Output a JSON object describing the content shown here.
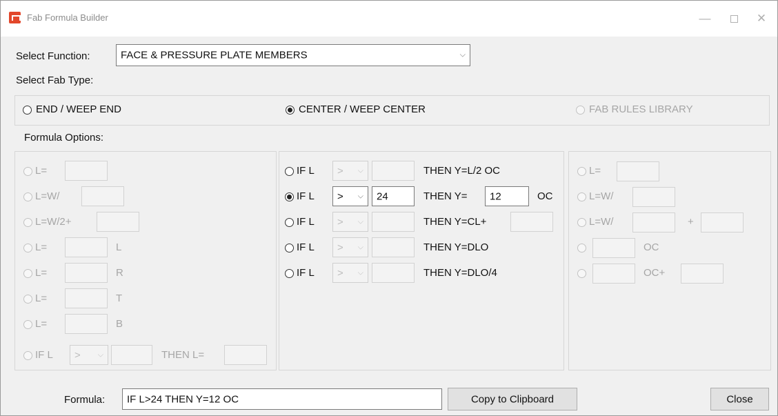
{
  "window": {
    "title": "Fab Formula Builder",
    "min_glyph": "—",
    "close_glyph": "✕"
  },
  "select_function": {
    "label": "Select Function:",
    "value": "FACE & PRESSURE PLATE MEMBERS"
  },
  "fab_type": {
    "label": "Select Fab Type:",
    "options": [
      {
        "label": "END / WEEP END",
        "checked": false,
        "enabled": true
      },
      {
        "label": "CENTER / WEEP CENTER",
        "checked": true,
        "enabled": true
      },
      {
        "label": "FAB RULES LIBRARY",
        "checked": false,
        "enabled": false
      }
    ]
  },
  "formula_options": {
    "label": "Formula Options:",
    "left": {
      "rows": [
        {
          "prefix": "L=",
          "suffix": "",
          "plus": ""
        },
        {
          "prefix": "L=W/",
          "suffix": "",
          "plus": ""
        },
        {
          "prefix": "L=W/2+",
          "suffix": "",
          "plus": ""
        },
        {
          "prefix": "L=",
          "suffix": "L",
          "plus": ""
        },
        {
          "prefix": "L=",
          "suffix": "R",
          "plus": ""
        },
        {
          "prefix": "L=",
          "suffix": "T",
          "plus": ""
        },
        {
          "prefix": "L=",
          "suffix": "B",
          "plus": ""
        }
      ],
      "if_row": {
        "prefix": "IF L",
        "operator": ">",
        "value": "",
        "then": "THEN L=",
        "result": ""
      }
    },
    "middle": {
      "rows": [
        {
          "prefix": "IF L",
          "operator": ">",
          "value": "",
          "then": "THEN Y=L/2 OC",
          "checked": false
        },
        {
          "prefix": "IF L",
          "operator": ">",
          "value": "24",
          "then": "THEN Y=",
          "result": "12",
          "suffix": "OC",
          "checked": true
        },
        {
          "prefix": "IF L",
          "operator": ">",
          "value": "",
          "then": "THEN Y=CL+",
          "checked": false
        },
        {
          "prefix": "IF L",
          "operator": ">",
          "value": "",
          "then": "THEN Y=DLO",
          "checked": false
        },
        {
          "prefix": "IF L",
          "operator": ">",
          "value": "",
          "then": "THEN Y=DLO/4",
          "checked": false
        }
      ]
    },
    "right": {
      "rows": [
        {
          "prefix": "L=",
          "suffix": ""
        },
        {
          "prefix": "L=W/",
          "suffix": ""
        },
        {
          "prefix": "L=W/",
          "suffix": "+"
        },
        {
          "prefix": "",
          "suffix": "OC"
        },
        {
          "prefix": "",
          "suffix": "OC+"
        }
      ]
    }
  },
  "formula": {
    "label": "Formula:",
    "value": "IF L>24 THEN Y=12 OC"
  },
  "buttons": {
    "copy": "Copy to Clipboard",
    "close": "Close"
  }
}
